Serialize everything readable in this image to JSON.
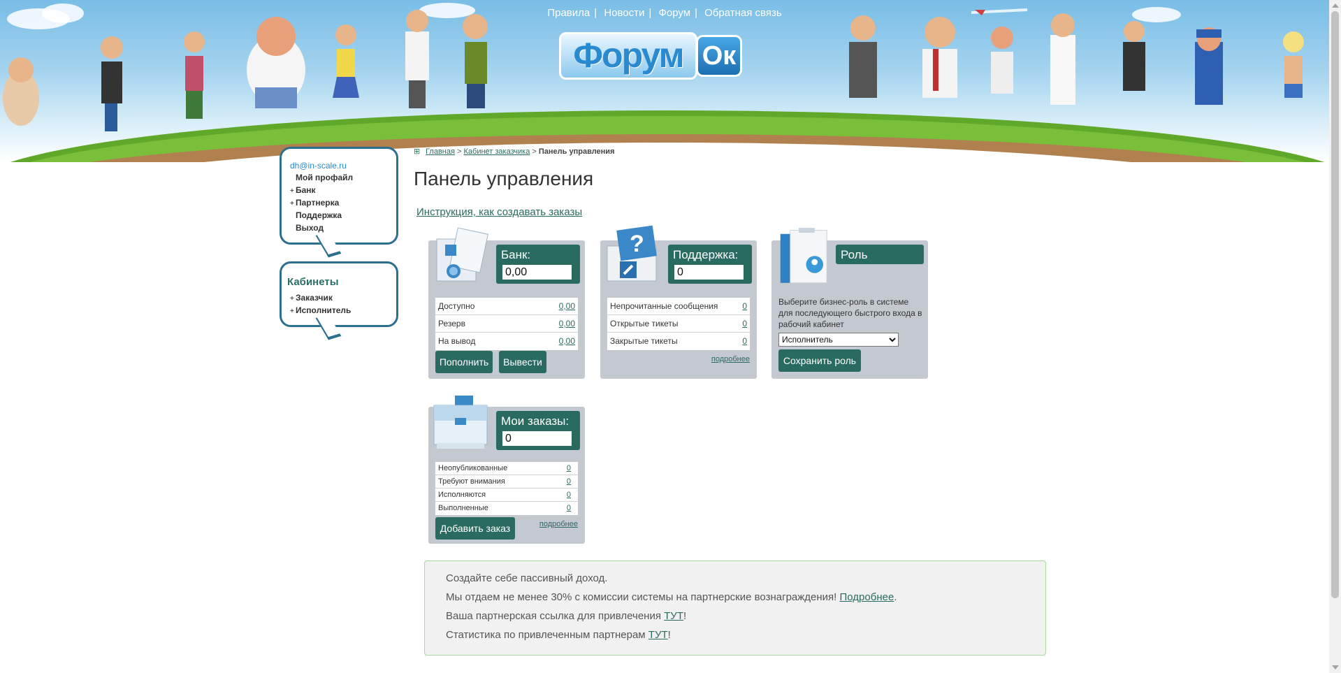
{
  "header": {
    "nav": [
      "Правила",
      "Новости",
      "Форум",
      "Обратная связь"
    ],
    "logo_main": "Форум",
    "logo_ok": "Ок"
  },
  "sidebar": {
    "email": "dh@in-scale.ru",
    "menu": [
      {
        "label": "Мой профайл",
        "plus": false
      },
      {
        "label": "Банк",
        "plus": true
      },
      {
        "label": "Партнерка",
        "plus": true
      },
      {
        "label": "Поддержка",
        "plus": false
      },
      {
        "label": "Выход",
        "plus": false
      }
    ],
    "cabinets_title": "Кабинеты",
    "cabinets": [
      {
        "label": "Заказчик"
      },
      {
        "label": "Исполнитель"
      }
    ]
  },
  "breadcrumb": {
    "home": "Главная",
    "sep": ">",
    "cabinet": "Кабинет заказчика",
    "current": "Панель управления"
  },
  "main": {
    "title": "Панель управления",
    "instruction_link": "Инструкция, как создавать заказы"
  },
  "bank": {
    "title": "Банк:",
    "value": "0,00",
    "rows": [
      {
        "label": "Доступно",
        "value": "0,00"
      },
      {
        "label": "Резерв",
        "value": "0,00"
      },
      {
        "label": "На вывод",
        "value": "0,00"
      }
    ],
    "btn_deposit": "Пополнить",
    "btn_withdraw": "Вывести"
  },
  "support": {
    "title": "Поддержка:",
    "value": "0",
    "rows": [
      {
        "label": "Непрочитанные сообщения",
        "value": "0"
      },
      {
        "label": "Открытые тикеты",
        "value": "0"
      },
      {
        "label": "Закрытые тикеты",
        "value": "0"
      }
    ],
    "more": "подробнее"
  },
  "role": {
    "title": "Роль",
    "description": "Выберите бизнес-роль в системе для последующего быстрого входа в рабочий кабинет",
    "selected": "Исполнитель",
    "save_button": "Сохранить роль"
  },
  "orders": {
    "title": "Мои заказы:",
    "value": "0",
    "rows": [
      {
        "label": "Неопубликованные",
        "value": "0"
      },
      {
        "label": "Требуют внимания",
        "value": "0"
      },
      {
        "label": "Исполняются",
        "value": "0"
      },
      {
        "label": "Выполненные",
        "value": "0"
      }
    ],
    "add_button": "Добавить заказ",
    "more": "подробнее"
  },
  "promo": {
    "line1": "Создайте себе пассивный доход.",
    "line2_text": "Мы отдаем не менее 30% с комиссии системы на партнерские вознаграждения!",
    "line2_link": "Подробнее",
    "line2_end": ".",
    "line3_text": "Ваша партнерская ссылка для привлечения",
    "line3_link": "ТУТ",
    "line3_end": "!",
    "line4_text": "Статистика по привлеченным партнерам",
    "line4_link": "ТУТ",
    "line4_end": "!"
  }
}
